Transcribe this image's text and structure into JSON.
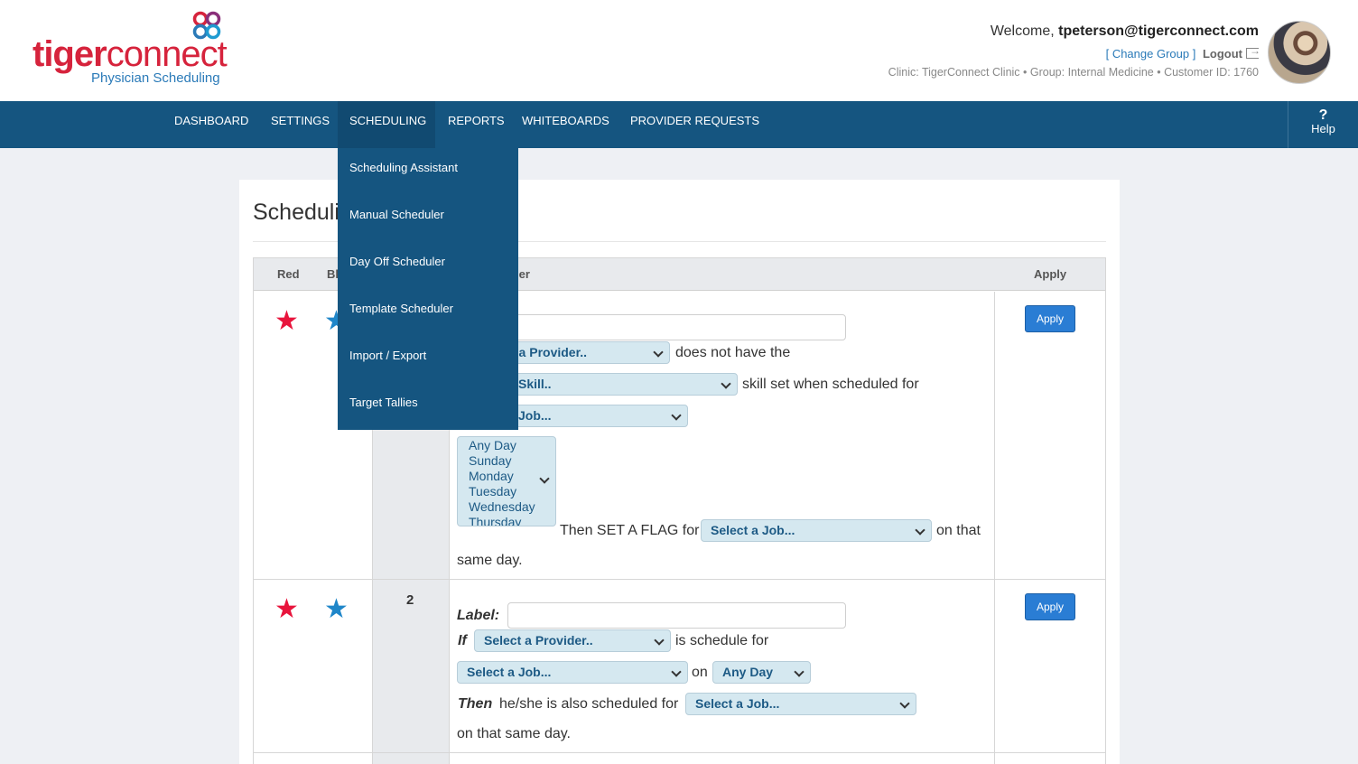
{
  "brand": {
    "logo_tiger": "tiger",
    "logo_connect": "connect",
    "logo_subtitle": "Physician Scheduling",
    "brand_color": "#d6233c"
  },
  "user": {
    "welcome_prefix": "Welcome,",
    "email": "tpeterson@tigerconnect.com",
    "change_group": "[ Change Group ]",
    "logout": "Logout",
    "clinic_line": "Clinic: TigerConnect Clinic • Group: Internal Medicine • Customer ID: 1760"
  },
  "nav": {
    "items": [
      "DASHBOARD",
      "SETTINGS",
      "SCHEDULING",
      "REPORTS",
      "WHITEBOARDS",
      "PROVIDER REQUESTS"
    ],
    "active": "SCHEDULING",
    "help_icon": "?",
    "help_label": "Help",
    "bar_color": "#155580"
  },
  "dropdown": {
    "items": [
      "Scheduling Assistant",
      "Manual Scheduler",
      "Day Off Scheduler",
      "Template Scheduler",
      "Import / Export",
      "Target Tallies"
    ]
  },
  "page": {
    "title": "Scheduli"
  },
  "table": {
    "headers": {
      "red": "Red",
      "blue": "Bl",
      "rule": "ler",
      "apply": "Apply"
    },
    "rows": [
      {
        "provider_select": "t a Provider..",
        "text_not_have": "does not have the",
        "skill_select": "Skill..",
        "text_skill_set": "skill set when scheduled for",
        "job_select": "Job...",
        "days": [
          "Any Day",
          "Sunday",
          "Monday",
          "Tuesday",
          "Wednesday",
          "Thursday"
        ],
        "text_then_flag": "Then SET A FLAG for",
        "flag_job_select": "Select a Job...",
        "text_on_that": "on that",
        "text_same_day": "same day.",
        "apply_label": "Apply"
      },
      {
        "number": "2",
        "label_text": "Label:",
        "if_text": "If",
        "provider_select": "Select a Provider..",
        "text_scheduled_for": "is schedule for",
        "job_select": "Select a Job...",
        "on_text": "on",
        "day_select": "Any Day",
        "then_text": "Then",
        "text_also": "he/she is also scheduled for",
        "then_job_select": "Select a Job...",
        "text_same_day": "on that same day.",
        "apply_label": "Apply"
      }
    ]
  },
  "icons": {
    "star": "★"
  }
}
